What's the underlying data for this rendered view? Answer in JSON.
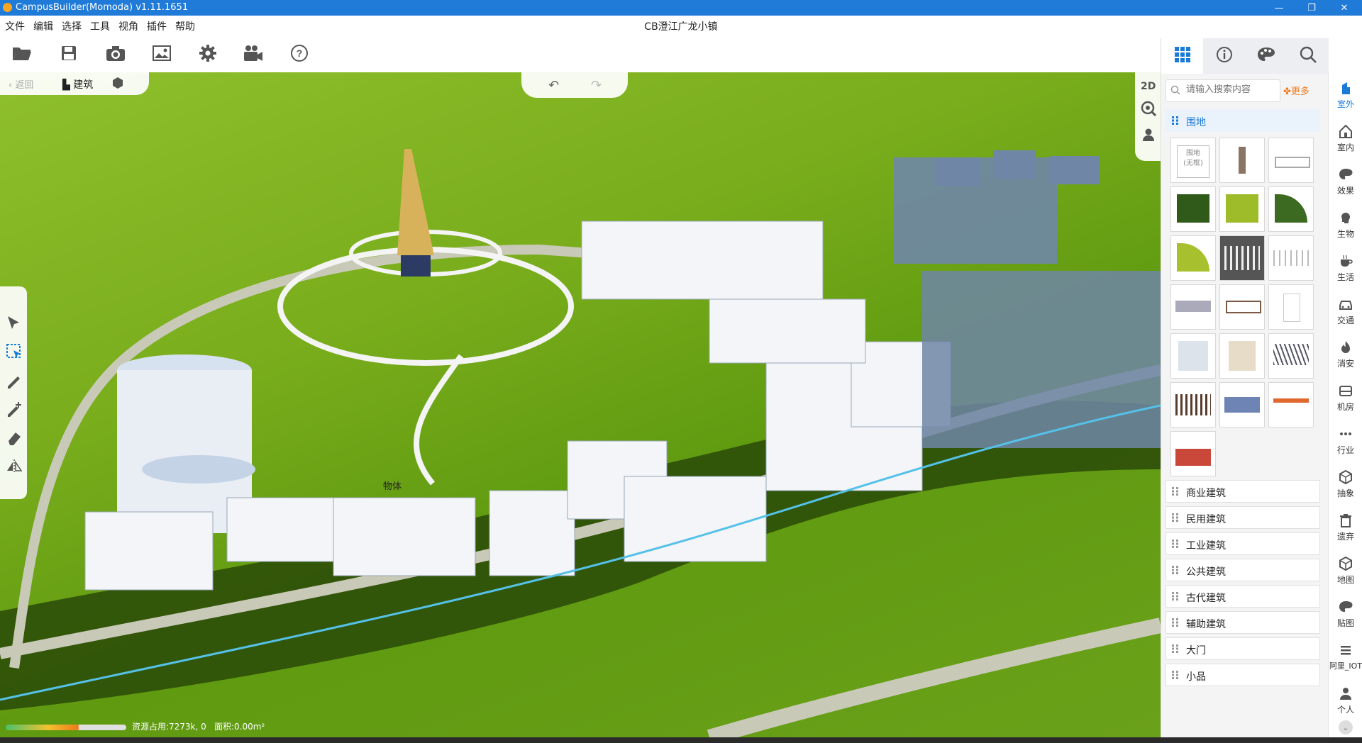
{
  "window": {
    "title": "CampusBuilder(Momoda) v1.11.1651",
    "controls": [
      "minimize-icon",
      "restore-icon",
      "close-icon"
    ]
  },
  "menu": {
    "items": [
      "文件",
      "编辑",
      "选择",
      "工具",
      "视角",
      "插件",
      "帮助"
    ],
    "document_title": "CB澄江广龙小镇"
  },
  "toolbar": {
    "icons": [
      "folder-open-icon",
      "save-icon",
      "camera-icon",
      "image-icon",
      "settings-icon",
      "video-camera-icon",
      "help-icon"
    ]
  },
  "viewport": {
    "nav": {
      "back_label": "返回",
      "building_label": "建筑"
    },
    "view_mode_label": "2D",
    "object_label": "物体",
    "status": {
      "resource_label": "资源占用:7273k, 0",
      "area_label": "面积:0.00m²"
    }
  },
  "right_panel": {
    "search_placeholder": "请输入搜索内容",
    "more_label": "更多",
    "active_category": "围地",
    "thumb_text_line1": "围地",
    "thumb_text_line2": "(无框)",
    "categories": [
      "商业建筑",
      "民用建筑",
      "工业建筑",
      "公共建筑",
      "古代建筑",
      "辅助建筑",
      "大门",
      "小品"
    ]
  },
  "rail": {
    "items": [
      {
        "label": "室外",
        "icon": "building-icon",
        "active": true
      },
      {
        "label": "室内",
        "icon": "home-icon"
      },
      {
        "label": "效果",
        "icon": "palette-icon"
      },
      {
        "label": "生物",
        "icon": "person-head-icon"
      },
      {
        "label": "生活",
        "icon": "cup-icon"
      },
      {
        "label": "交通",
        "icon": "car-icon"
      },
      {
        "label": "消安",
        "icon": "flame-icon"
      },
      {
        "label": "机房",
        "icon": "server-icon"
      },
      {
        "label": "行业",
        "icon": "dots-icon"
      },
      {
        "label": "抽象",
        "icon": "cube-icon"
      },
      {
        "label": "遗弃",
        "icon": "trash-icon"
      },
      {
        "label": "地图",
        "icon": "map-cube-icon"
      },
      {
        "label": "贴图",
        "icon": "texture-icon"
      },
      {
        "label": "阿里_IOT",
        "icon": "menu-icon"
      },
      {
        "label": "个人",
        "icon": "user-icon"
      }
    ]
  },
  "colors": {
    "titlebar": "#1f7ad8",
    "accent": "#1a7ad8",
    "more": "#f07a1a",
    "grass": "#7cb21e"
  }
}
